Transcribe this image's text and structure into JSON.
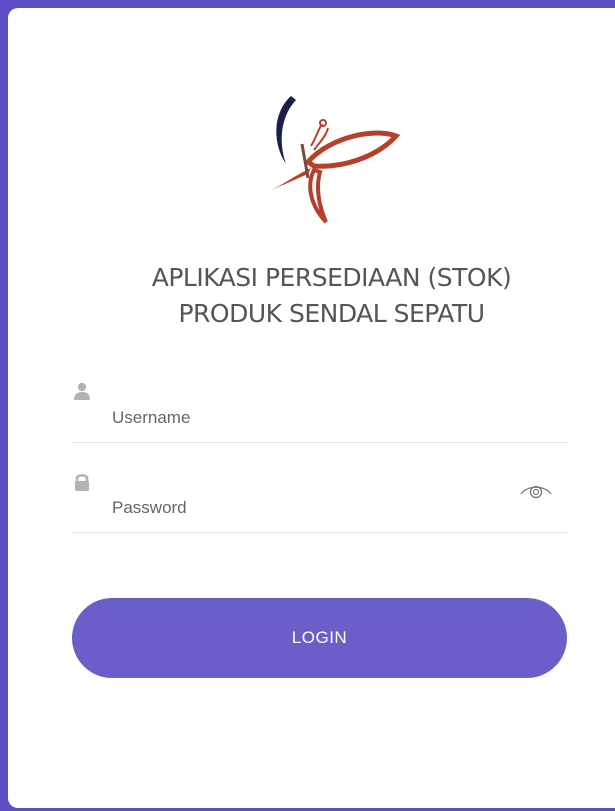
{
  "app": {
    "title_line1": "APLIKASI PERSEDIAAN (STOK)",
    "title_line2": "PRODUK SENDAL SEPATU"
  },
  "logo": {
    "icon": "butterfly-logo",
    "colors": {
      "dark": "#1c1f4a",
      "accent": "#b5402c"
    }
  },
  "form": {
    "username": {
      "value": "",
      "placeholder": "Username",
      "icon": "user-icon"
    },
    "password": {
      "value": "",
      "placeholder": "Password",
      "icon": "lock-icon",
      "toggle_icon": "eye-icon"
    },
    "login_label": "LOGIN"
  },
  "colors": {
    "background": "#5a4fc4",
    "button": "#6a5fc8",
    "icon": "#b3b3b3"
  }
}
